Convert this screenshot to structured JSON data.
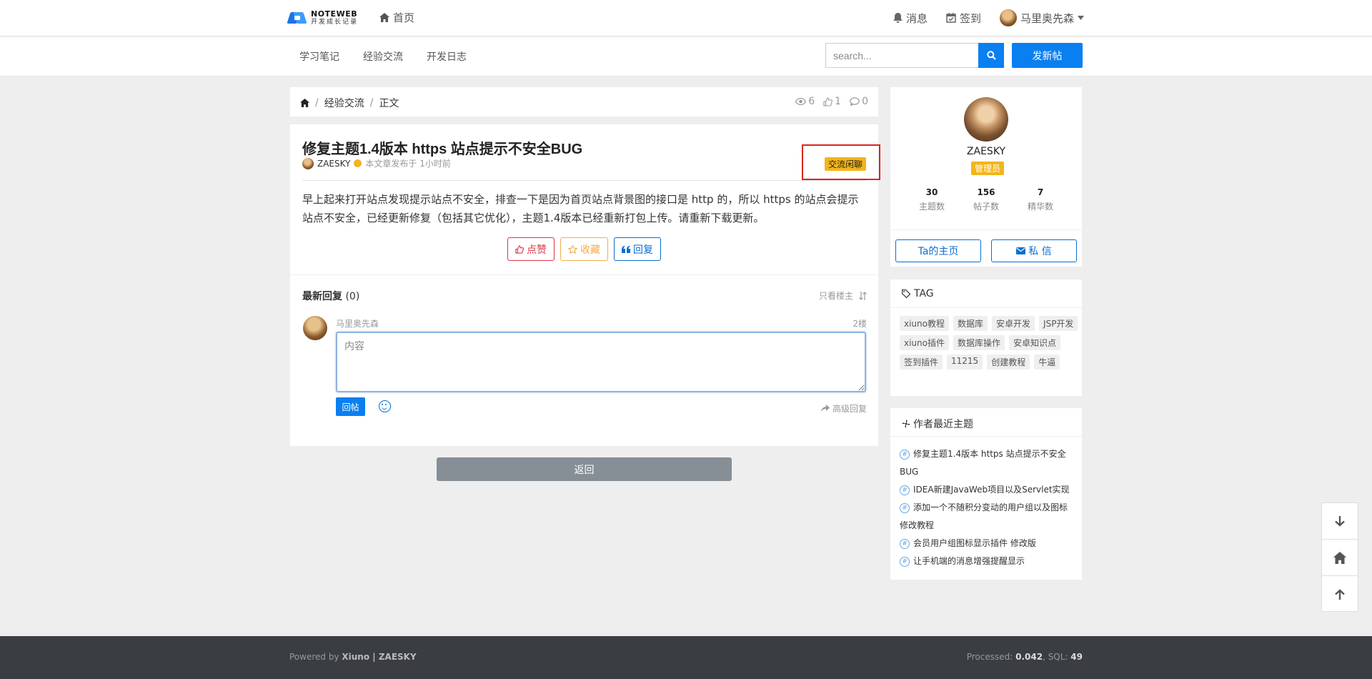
{
  "header": {
    "logo_title": "NOTEWEB",
    "logo_subtitle": "开发成长记录",
    "home_label": "首页",
    "messages_label": "消息",
    "checkin_label": "签到",
    "username": "马里奥先森"
  },
  "subnav": {
    "items": [
      "学习笔记",
      "经验交流",
      "开发日志"
    ],
    "search_placeholder": "search...",
    "new_post_label": "发新帖"
  },
  "breadcrumb": {
    "items": [
      "经验交流",
      "正文"
    ],
    "views": "6",
    "likes": "1",
    "comments": "0"
  },
  "article": {
    "title": "修复主题1.4版本 https 站点提示不安全BUG",
    "author": "ZAESKY",
    "posted": "本文章发布于 1小时前",
    "category": "交流闲聊",
    "content": "早上起来打开站点发现提示站点不安全，排查一下是因为首页站点背景图的接口是 http 的，所以 https 的站点会提示站点不安全，已经更新修复（包括其它优化），主题1.4版本已经重新打包上传。请重新下载更新。",
    "like_label": "点赞",
    "fav_label": "收藏",
    "reply_label": "回复"
  },
  "replies": {
    "heading": "最新回复",
    "count": "(0)",
    "only_author": "只看楼主",
    "current_user": "马里奥先森",
    "floor": "2楼",
    "placeholder": "内容",
    "submit_label": "回帖",
    "advanced_label": "高级回复"
  },
  "back_label": "返回",
  "profile": {
    "name": "ZAESKY",
    "role": "管理员",
    "stats": [
      {
        "num": "30",
        "label": "主题数"
      },
      {
        "num": "156",
        "label": "帖子数"
      },
      {
        "num": "7",
        "label": "精华数"
      }
    ],
    "homepage_label": "Ta的主页",
    "message_label": "私 信"
  },
  "tags": {
    "heading": "TAG",
    "items": [
      "xiuno教程",
      "数据库",
      "安卓开发",
      "JSP开发",
      "xiuno插件",
      "数据库操作",
      "安卓知识点",
      "签到插件",
      "11215",
      "创建教程",
      "牛逼"
    ]
  },
  "recent": {
    "heading": "作者最近主题",
    "items": [
      "修复主题1.4版本 https 站点提示不安全BUG",
      "IDEA新建JavaWeb项目以及Servlet实现",
      "添加一个不随积分变动的用户组以及图标修改教程",
      "会员用户组图标显示插件 修改版",
      "让手机端的消息增强提醒显示"
    ]
  },
  "footer": {
    "powered_prefix": "Powered by ",
    "powered_xiuno": "Xiuno",
    "powered_sep": " | ",
    "powered_site": "ZAESKY",
    "processed_label": "Processed: ",
    "processed_value": "0.042",
    "sql_label": ", SQL: ",
    "sql_value": "49"
  },
  "colors": {
    "accent": "#0a7ff0",
    "badge": "#f3b51a",
    "highlight": "#d9261c",
    "footer": "#3a3e42"
  }
}
